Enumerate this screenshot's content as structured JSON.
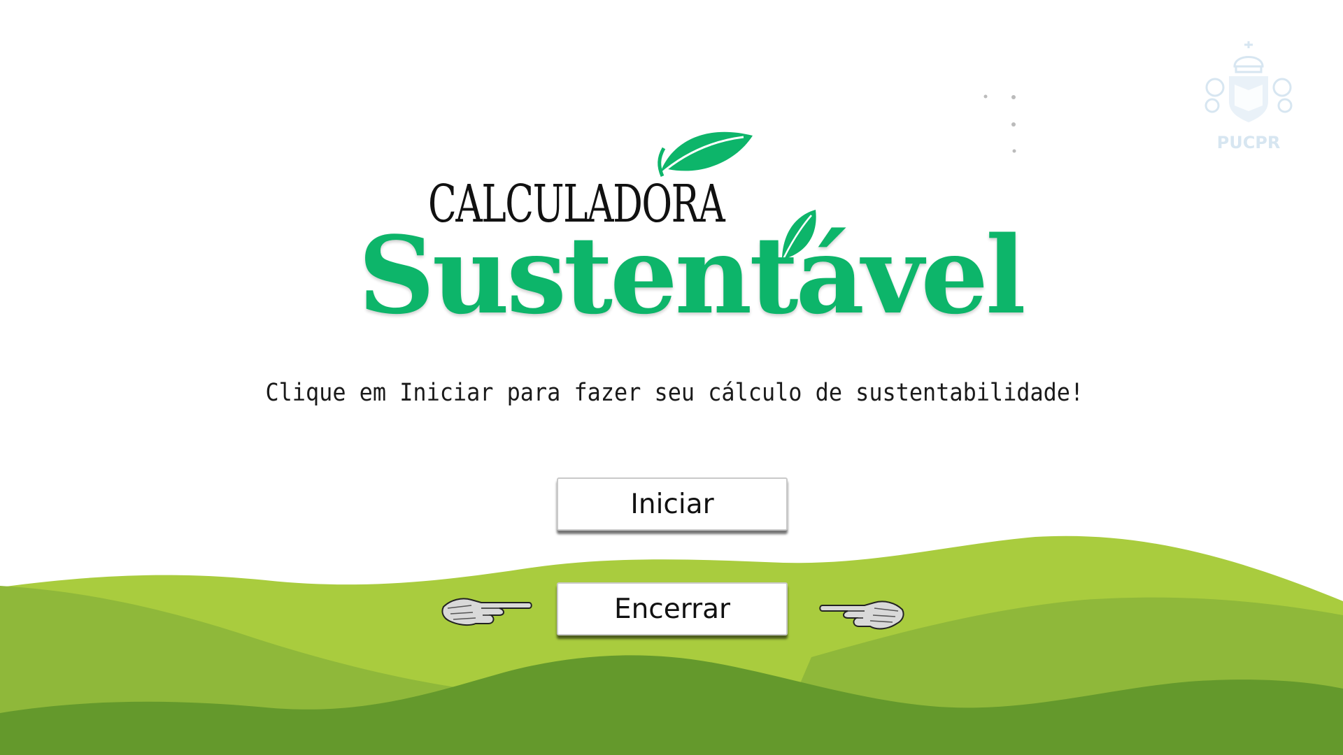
{
  "logo": {
    "title": "CALCULADORA",
    "word": "Sustentável"
  },
  "subtitle": "Clique em Iniciar para fazer seu cálculo de sustentabilidade!",
  "buttons": {
    "start_label": "Iniciar",
    "end_label": "Encerrar"
  },
  "seal": {
    "label": "PUCPR"
  },
  "icons": {
    "leaf": "leaf-icon",
    "hand_left": "pointing-hand-right-icon",
    "hand_right": "pointing-hand-left-icon",
    "seal": "pucpr-crest-icon"
  },
  "colors": {
    "brand_green": "#0db56a",
    "hill_light": "#a9cc3e",
    "hill_mid": "#8fb83a",
    "hill_dark": "#64992c",
    "background": "#ffffff"
  }
}
